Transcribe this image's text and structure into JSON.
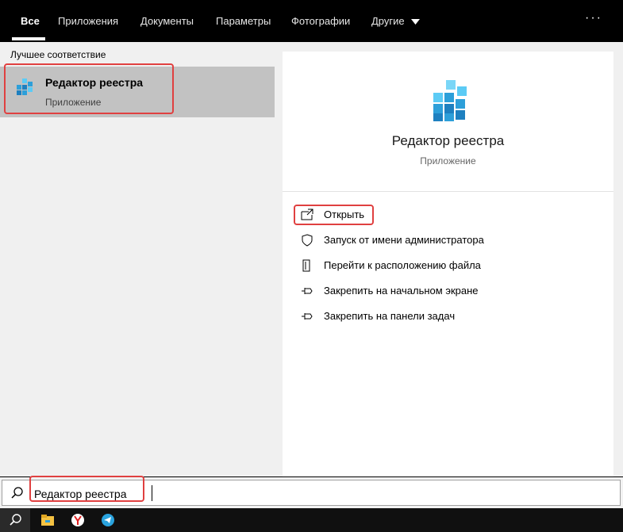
{
  "tabs": [
    {
      "label": "Все",
      "active": true
    },
    {
      "label": "Приложения"
    },
    {
      "label": "Документы"
    },
    {
      "label": "Параметры"
    },
    {
      "label": "Фотографии"
    },
    {
      "label": "Другие"
    }
  ],
  "more_label": "···",
  "best_match": {
    "header": "Лучшее соответствие",
    "title": "Редактор реестра",
    "subtitle": "Приложение"
  },
  "detail": {
    "title": "Редактор реестра",
    "subtitle": "Приложение",
    "actions": [
      {
        "label": "Открыть",
        "icon": "open-window-icon"
      },
      {
        "label": "Запуск от имени администратора",
        "icon": "admin-shield-icon"
      },
      {
        "label": "Перейти к расположению файла",
        "icon": "file-location-icon"
      },
      {
        "label": "Закрепить на начальном экране",
        "icon": "pin-icon"
      },
      {
        "label": "Закрепить на панели задач",
        "icon": "pin-icon"
      }
    ]
  },
  "search": {
    "value": "Редактор реестра"
  },
  "taskbar": [
    "search-icon",
    "file-explorer-icon",
    "yandex-browser-icon",
    "telegram-icon"
  ],
  "colors": {
    "accent": "#2d9fd9",
    "highlight": "#e04040",
    "selected": "#c2c2c2"
  }
}
